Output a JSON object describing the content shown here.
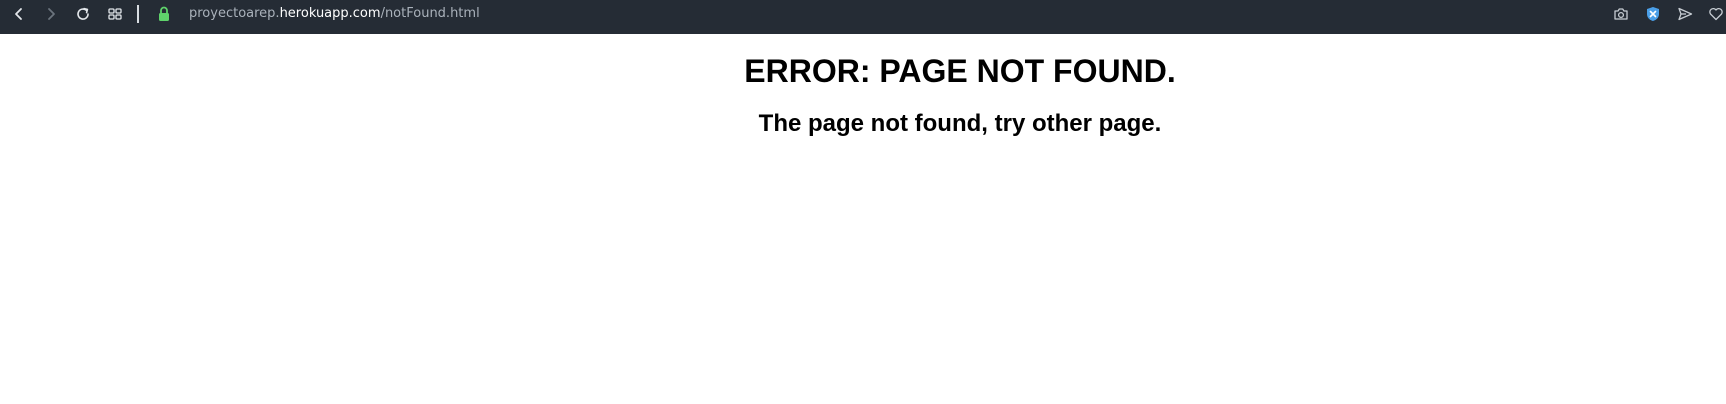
{
  "browser": {
    "toolbar_color": "#252c35",
    "icons": [
      "back-icon",
      "forward-icon",
      "reload-icon",
      "speed-dial-icon",
      "lock-icon",
      "camera-icon",
      "extension-icon",
      "send-icon",
      "heart-icon"
    ],
    "address_bar": {
      "prefix": "proyectoarep.",
      "host": "herokuapp.com",
      "path": "/notFound.html"
    }
  },
  "page": {
    "title": "ERROR: PAGE NOT FOUND.",
    "subtitle": "The page not found, try other page."
  }
}
